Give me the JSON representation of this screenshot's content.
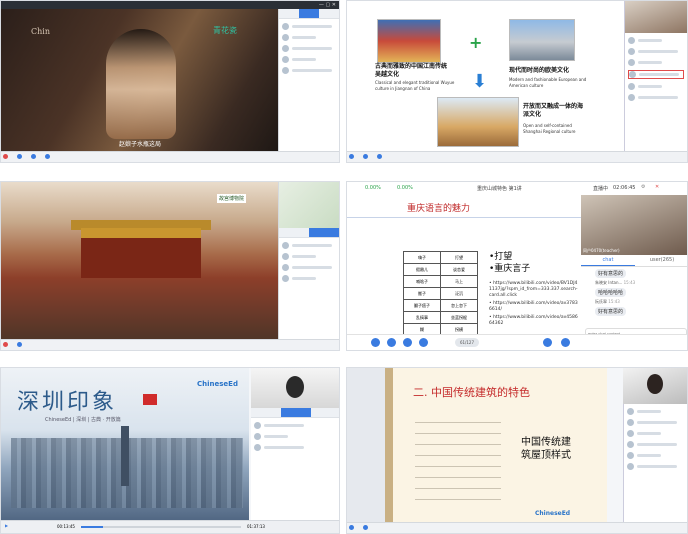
{
  "tile1": {
    "watermark_left": "Chin",
    "watermark_right_top": "",
    "watermark_right_big": "青花瓷",
    "subtitle": "赵娘子水瓶这局"
  },
  "tile2": {
    "caption_a_cn": "古典而雅致的中国江南传统吴越文化",
    "caption_a_en": "Classical and elegant traditional Wuyue culture in Jiangnan of China",
    "caption_b_cn": "现代而时尚的欧美文化",
    "caption_b_en": "Modern and fashionable European and American culture",
    "caption_c_cn": "开放而又融成一体的海派文化",
    "caption_c_en": "Open and self-contained Shanghai Regional culture"
  },
  "tile3": {
    "logo_text": "故宫博物院"
  },
  "tile4": {
    "stat_left": "0.00%",
    "stat_mid": "0.00%",
    "session_title": "重庆山城特色 第1讲",
    "timer_label": "直播中",
    "timer": "02:06:45",
    "slide_title": "重庆语言的魅力",
    "table_rows": [
      [
        "嗨子",
        "打望"
      ],
      [
        "假嫩儿",
        "谈恋爱"
      ],
      [
        "喊啥子",
        "马上"
      ],
      [
        "搬子",
        "泛沉"
      ],
      [
        "翻子痞子",
        "忽上忽下"
      ],
      [
        "乱搞事",
        "坐蓝拐棍"
      ],
      [
        "糊",
        "拐横"
      ],
      [
        "要达",
        "扯"
      ]
    ],
    "big_lines": [
      "•打望",
      "•重庆言子"
    ],
    "links": [
      "• https://www.bilibili.com/video/BV1DJ41137jg/?spm_id_from=333.337.search-card.all.click",
      "• https://www.bilibili.com/video/av37836614/",
      "• https://www.bilibili.com/video/av458664362"
    ],
    "teacher_label": "同户0470(teacher)",
    "tab_chat": "chat",
    "tab_user": "user(265)",
    "messages": [
      {
        "text": "好有意思的",
        "time": ""
      },
      {
        "name": "朱晓安 Intan...",
        "text": "哈哈哈哈哈",
        "time": "15:43"
      },
      {
        "name": "阮氏翠",
        "text": "好有意思的",
        "time": "15:43"
      }
    ],
    "chat_placeholder": "enter chat content",
    "page_indicator": "61/127"
  },
  "tile5": {
    "title": "深圳印象",
    "subtitle": "ChineseEd | 深圳 | 古典 · 开放篇",
    "brand": "ChineseEd",
    "time_current": "00:13:45",
    "time_total": "01:37:13"
  },
  "tile6": {
    "title": "二. 中国传统建筑的特色",
    "body": "中国传统建筑屋顶样式",
    "brand": "ChineseEd"
  }
}
